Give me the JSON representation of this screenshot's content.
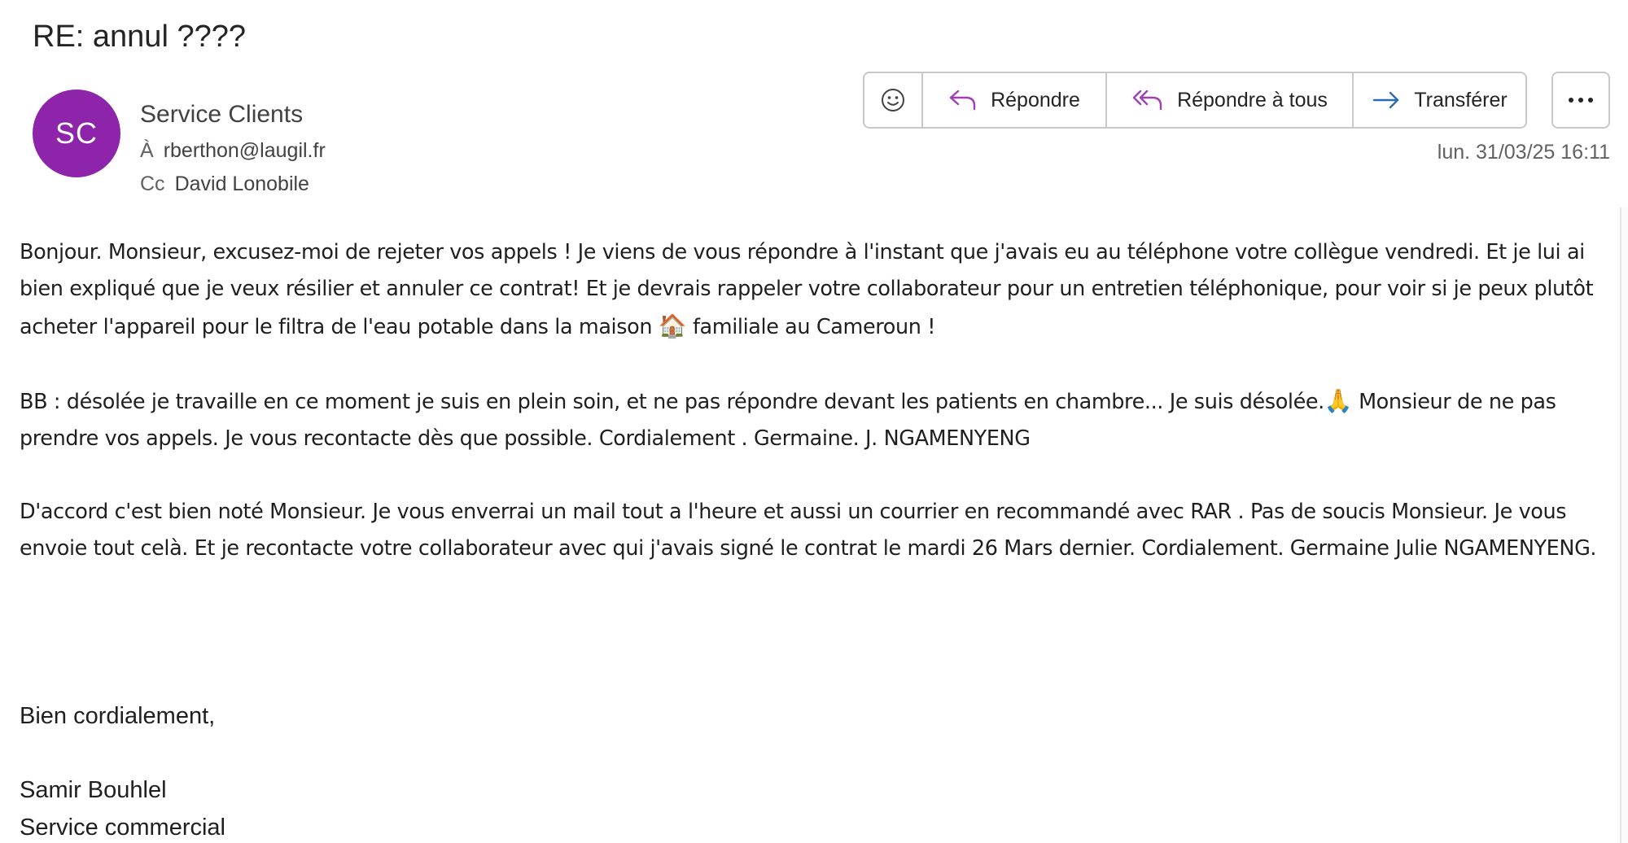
{
  "message": {
    "subject": "RE: annul ????",
    "avatar_initials": "SC",
    "avatar_color": "#8e24aa",
    "sender": "Service Clients",
    "to_label": "À",
    "to": "rberthon@laugil.fr",
    "cc_label": "Cc",
    "cc": "David Lonobile",
    "timestamp": "lun. 31/03/25 16:11"
  },
  "actions": {
    "emoji_icon": "smiley-icon",
    "reply_label": "Répondre",
    "reply_all_label": "Répondre à tous",
    "forward_label": "Transférer",
    "more_icon": "more-dots-icon",
    "accent_color": "#a03fb5",
    "forward_color": "#2b6cb0"
  },
  "body": {
    "p1_before_emoji": "Bonjour. Monsieur, excusez-moi de rejeter vos appels ! Je viens de vous répondre à  l'instant que j'avais eu au téléphone votre collègue vendredi. Et je lui ai bien expliqué que je veux résilier et annuler ce contrat! Et je devrais rappeler votre collaborateur pour un entretien téléphonique, pour voir si je peux plutôt acheter l'appareil pour le filtra de l'eau potable dans la maison",
    "p1_emoji": "🏠",
    "p1_after_emoji": "familiale au Cameroun !",
    "p2_before_emoji": "BB : désolée je travaille en ce moment je suis en plein soin, et ne pas répondre devant les patients en chambre... Je suis désolée.",
    "p2_emoji": "🙏",
    "p2_after_emoji": "Monsieur de ne pas prendre vos appels. Je vous recontacte dès que possible. Cordialement . Germaine. J. NGAMENYENG",
    "p3": "D'accord c'est bien noté Monsieur. Je vous enverrai un mail  tout a l'heure et aussi un courrier  en recommandé  avec RAR . Pas de soucis Monsieur. Je vous envoie tout celà. Et je recontacte votre collaborateur avec qui j'avais signé le contrat le mardi 26 Mars dernier. Cordialement. Germaine Julie NGAMENYENG."
  },
  "signature": {
    "greeting": "Bien cordialement,",
    "name": "Samir Bouhlel",
    "department": "Service commercial"
  }
}
